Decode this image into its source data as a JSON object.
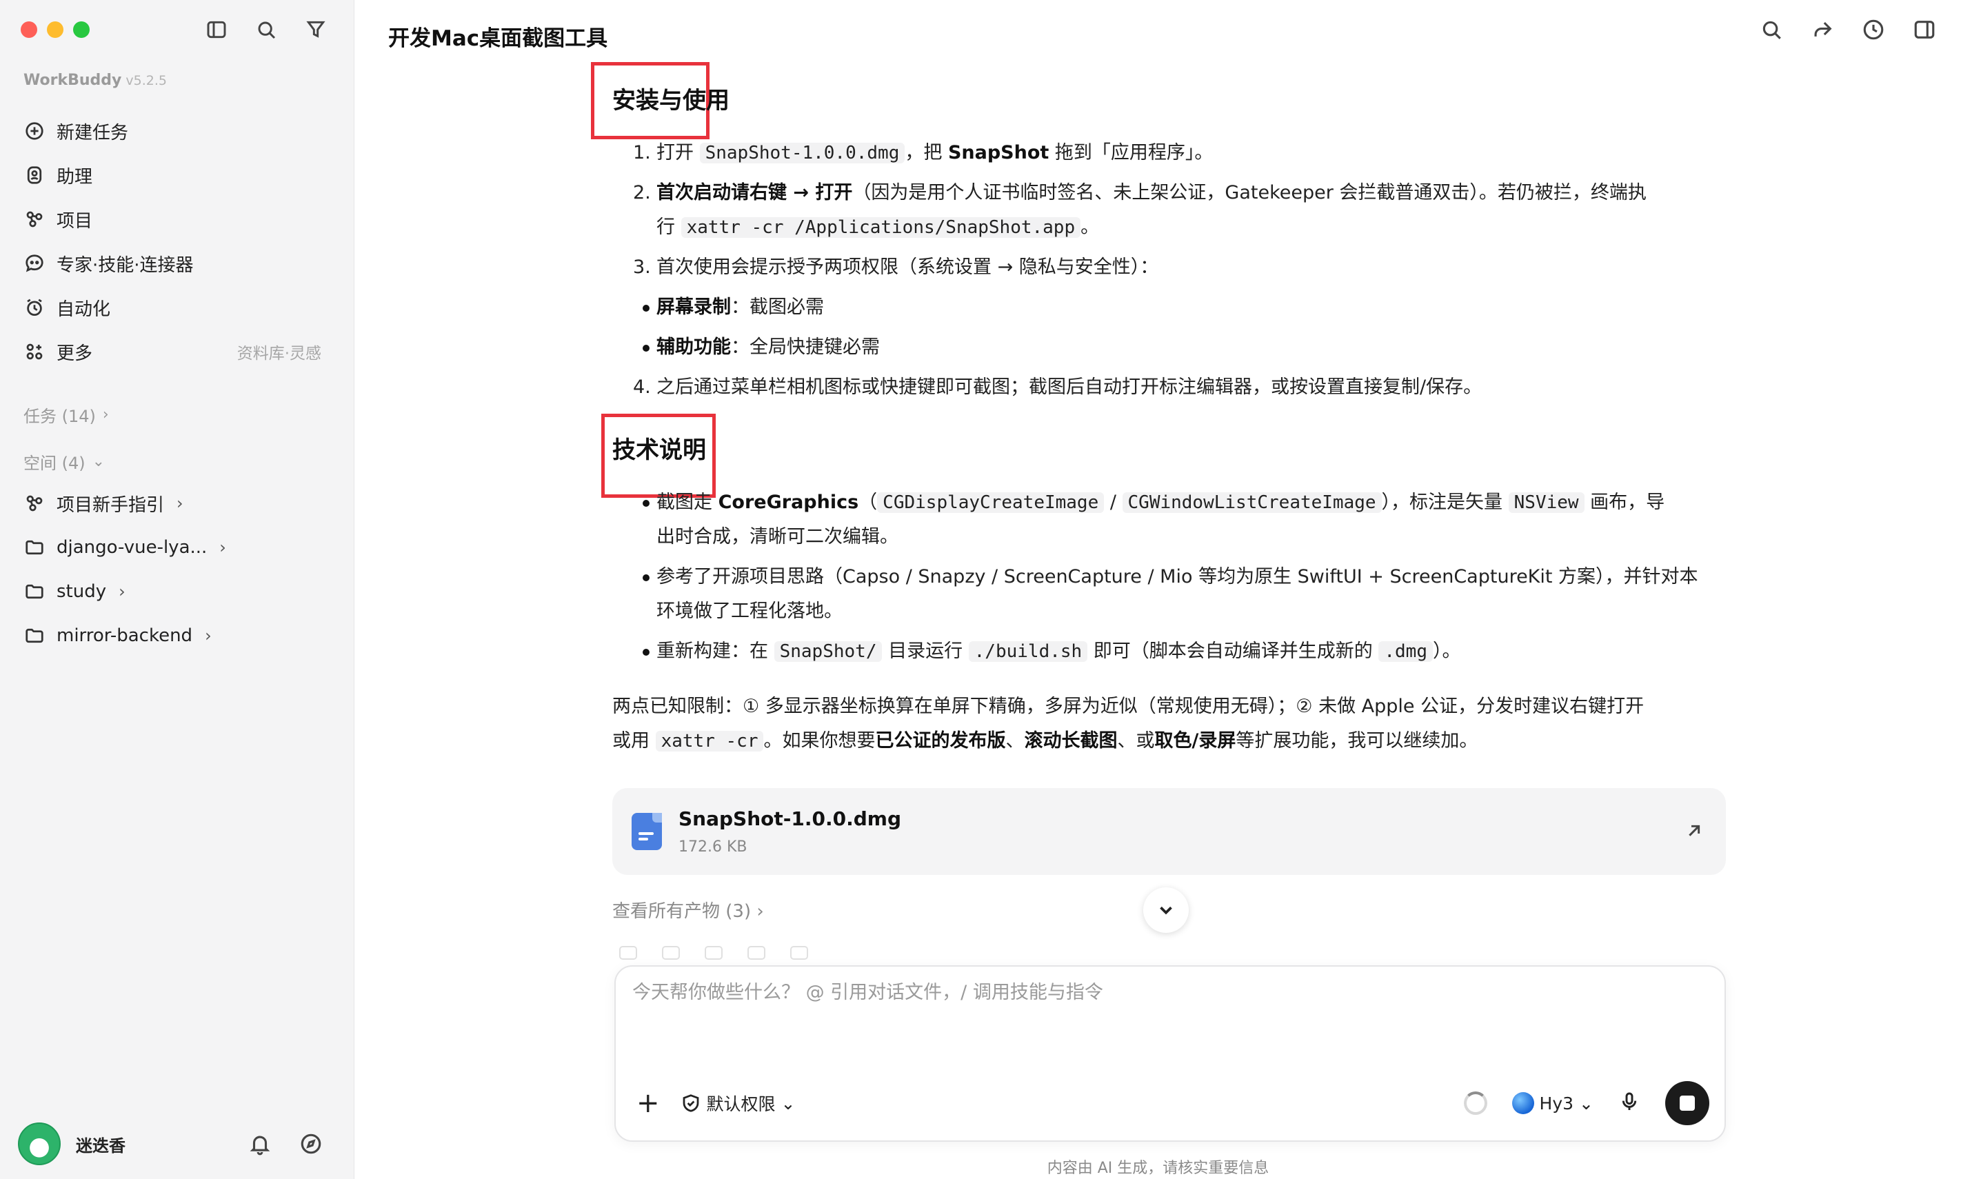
{
  "app": {
    "name": "WorkBuddy",
    "version": "v5.2.5"
  },
  "sidebar": {
    "nav": [
      {
        "label": "新建任务",
        "icon": "plus-circle-icon"
      },
      {
        "label": "助理",
        "icon": "assistant-icon"
      },
      {
        "label": "项目",
        "icon": "project-icon"
      },
      {
        "label": "专家·技能·连接器",
        "icon": "expert-icon"
      },
      {
        "label": "自动化",
        "icon": "alarm-clock-icon"
      },
      {
        "label": "更多",
        "icon": "grid-icon",
        "extra": "资料库·灵感"
      }
    ],
    "tasks_label": "任务 (14)",
    "spaces_label": "空间 (4)",
    "spaces": [
      {
        "label": "项目新手指引",
        "icon": "project-icon"
      },
      {
        "label": "django-vue-lya...",
        "icon": "folder-icon"
      },
      {
        "label": "study",
        "icon": "folder-icon"
      },
      {
        "label": "mirror-backend",
        "icon": "folder-icon"
      }
    ],
    "user": {
      "name": "迷迭香"
    }
  },
  "main": {
    "title": "开发Mac桌面截图工具",
    "section1": {
      "heading": "安装与使用",
      "step1": {
        "a": "打开 ",
        "code": "SnapShot-1.0.0.dmg",
        "b": "，把 ",
        "bold": "SnapShot",
        "c": " 拖到「应用程序」。"
      },
      "step2": {
        "bold": "首次启动请右键 → 打开",
        "a": "（因为是用个人证书临时签名、未上架公证，Gatekeeper 会拦截普通双击）。若仍被拦，终端执",
        "b": "行 ",
        "code": "xattr -cr /Applications/SnapShot.app",
        "c": "。"
      },
      "step3": "首次使用会提示授予两项权限（系统设置 → 隐私与安全性）：",
      "bullet1": {
        "bold": "屏幕录制",
        "text": "：截图必需"
      },
      "bullet2": {
        "bold": "辅助功能",
        "text": "：全局快捷键必需"
      },
      "step4": "之后通过菜单栏相机图标或快捷键即可截图；截图后自动打开标注编辑器，或按设置直接复制/保存。"
    },
    "section2": {
      "heading": "技术说明",
      "b1": {
        "a": "截图走 ",
        "bold": "CoreGraphics",
        "b": "（",
        "code1": "CGDisplayCreateImage",
        "c": " / ",
        "code2": "CGWindowListCreateImage",
        "d": "），标注是矢量 ",
        "code3": "NSView",
        "e": " 画布，导",
        "f": "出时合成，清晰可二次编辑。"
      },
      "b2": {
        "a": "参考了开源项目思路（Capso / Snapzy / ScreenCapture / Mio 等均为原生 SwiftUI + ScreenCaptureKit 方案），并针对本",
        "b": "环境做了工程化落地。"
      },
      "b3": {
        "a": "重新构建：在 ",
        "code1": "SnapShot/",
        "b": " 目录运行 ",
        "code2": "./build.sh",
        "c": " 即可（脚本会自动编译并生成新的 ",
        "code3": ".dmg",
        "d": "）。"
      }
    },
    "limits": {
      "a": "两点已知限制：① 多显示器坐标换算在单屏下精确，多屏为近似（常规使用无碍）；② 未做 Apple 公证，分发时建议右键打开",
      "b": "或用 ",
      "code": "xattr -cr",
      "c": "。如果你想要",
      "bold1": "已公证的发布版",
      "d": "、",
      "bold2": "滚动长截图",
      "e": "、或",
      "bold3": "取色/录屏",
      "f": "等扩展功能，我可以继续加。"
    },
    "file": {
      "name": "SnapShot-1.0.0.dmg",
      "size": "172.6 KB"
    },
    "view_all": "查看所有产物 (3)",
    "composer": {
      "placeholder": "今天帮你做些什么？ @ 引用对话文件，/ 调用技能与指令",
      "permission": "默认权限",
      "model": "Hy3"
    },
    "disclaimer": "内容由 AI 生成，请核实重要信息"
  }
}
